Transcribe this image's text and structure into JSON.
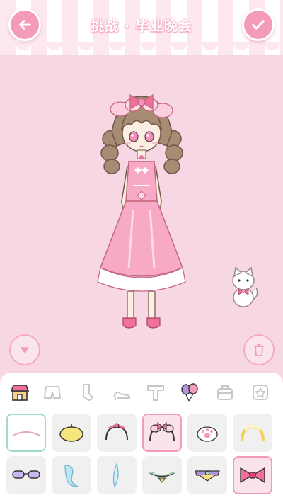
{
  "header": {
    "title": "挑战 · 毕业晚会",
    "back_icon": "back-arrow-icon",
    "confirm_icon": "checkmark-icon"
  },
  "stage": {
    "character": "doll-in-pink-lolita-dress",
    "pet": "white-cat-with-pink-bow",
    "collapse_icon": "chevron-down-icon",
    "delete_icon": "trash-icon"
  },
  "tabs": [
    {
      "icon": "shop-icon",
      "selected": true
    },
    {
      "icon": "shorts-icon",
      "selected": false
    },
    {
      "icon": "sock-icon",
      "selected": false
    },
    {
      "icon": "high-heel-icon",
      "selected": false
    },
    {
      "icon": "top-icon",
      "selected": false
    },
    {
      "icon": "balloons-icon",
      "selected": false
    },
    {
      "icon": "bag-icon",
      "selected": false
    },
    {
      "icon": "star-badge-icon",
      "selected": false
    }
  ],
  "items": [
    {
      "icon": "text-headband-icon",
      "state": "selected-green"
    },
    {
      "icon": "beret-icon",
      "state": "normal"
    },
    {
      "icon": "lace-headband-icon",
      "state": "normal"
    },
    {
      "icon": "bow-headband-icon",
      "state": "selected-pink"
    },
    {
      "icon": "paw-hairclip-icon",
      "state": "normal"
    },
    {
      "icon": "yellow-headband-icon",
      "state": "normal"
    },
    {
      "icon": "sunglasses-icon",
      "state": "normal"
    },
    {
      "icon": "veil-icon",
      "state": "normal"
    },
    {
      "icon": "feather-icon",
      "state": "normal"
    },
    {
      "icon": "ribbon-clip-icon",
      "state": "normal"
    },
    {
      "icon": "rainbow-clip-icon",
      "state": "normal"
    },
    {
      "icon": "red-bow-icon",
      "state": "selected-pink"
    }
  ],
  "colors": {
    "background": "#f7d7e4",
    "accent": "#f49bbb",
    "selected_green": "#9fdcc3"
  }
}
